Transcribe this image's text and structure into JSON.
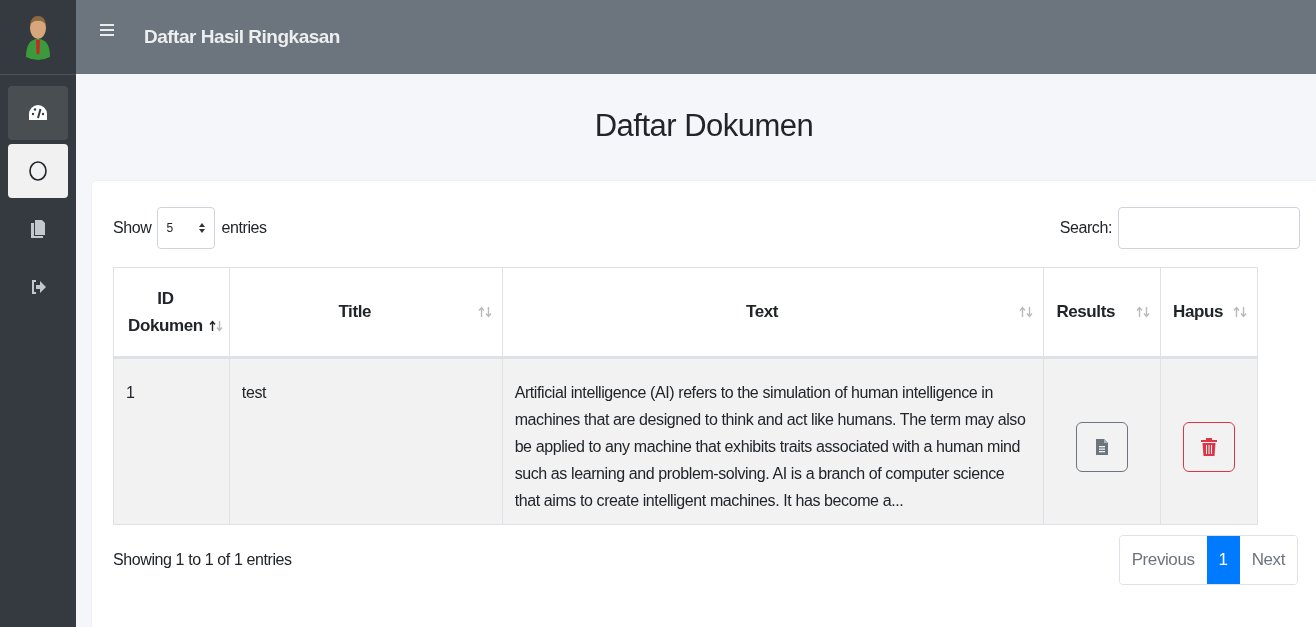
{
  "topbar": {
    "title": "Daftar Hasil Ringkasan"
  },
  "sidebar": {
    "items": [
      {
        "kind": "dashboard",
        "selected": false,
        "highlighted": true
      },
      {
        "kind": "circle",
        "selected": true,
        "highlighted": false
      },
      {
        "kind": "copy",
        "selected": false,
        "highlighted": false
      },
      {
        "kind": "logout",
        "selected": false,
        "highlighted": false
      }
    ]
  },
  "page_title": "Daftar Dokumen",
  "length": {
    "before": "Show",
    "value": "5",
    "after": "entries"
  },
  "search": {
    "label": "Search:"
  },
  "table": {
    "columns": [
      {
        "label": "ID Dokumen",
        "sorted_ascending": true
      },
      {
        "label": "Title",
        "sorted_ascending": false
      },
      {
        "label": "Text",
        "sorted_ascending": false
      },
      {
        "label": "Results",
        "sorted_ascending": false
      },
      {
        "label": "Hapus",
        "sorted_ascending": false
      }
    ],
    "rows": [
      {
        "id": "1",
        "title": "test",
        "text": "Artificial intelligence (AI) refers to the simulation of human intelligence in machines that are designed to think and act like humans. The term may also be applied to any machine that exhibits traits associated with a human mind such as learning and problem-solving. AI is a branch of computer science that aims to create intelligent machines. It has become a..."
      }
    ]
  },
  "info": "Showing 1 to 1 of 1 entries",
  "pagination": [
    {
      "label": "Previous",
      "selected": false
    },
    {
      "label": "1",
      "selected": true
    },
    {
      "label": "Next",
      "selected": false
    }
  ]
}
